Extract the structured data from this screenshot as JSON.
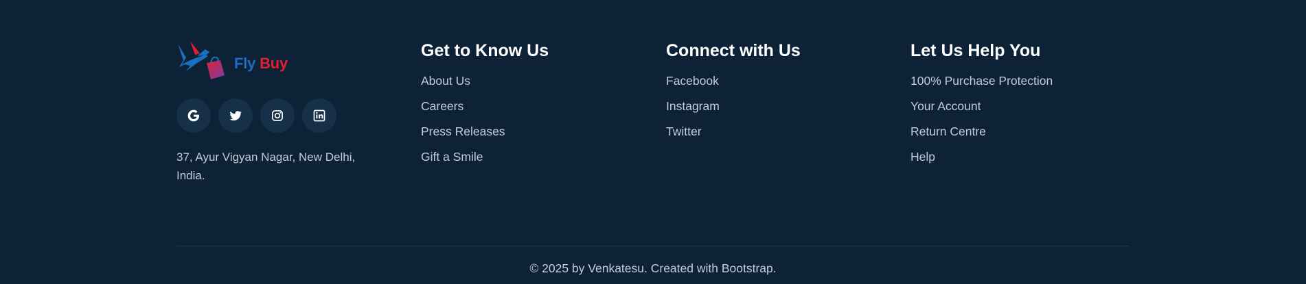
{
  "brand": {
    "name_part1": "Fly",
    "name_part2": "Buy",
    "address": "37, Ayur Vigyan Nagar, New Delhi, India.",
    "colors": {
      "blue": "#1a6fc1",
      "red": "#e02031",
      "background": "#0d2236"
    }
  },
  "socials": [
    {
      "icon": "google-icon"
    },
    {
      "icon": "twitter-icon"
    },
    {
      "icon": "instagram-icon"
    },
    {
      "icon": "linkedin-icon"
    }
  ],
  "columns": [
    {
      "heading": "Get to Know Us",
      "links": [
        "About Us",
        "Careers",
        "Press Releases",
        "Gift a Smile"
      ]
    },
    {
      "heading": "Connect with Us",
      "links": [
        "Facebook",
        "Instagram",
        "Twitter"
      ]
    },
    {
      "heading": "Let Us Help You",
      "links": [
        "100% Purchase Protection",
        "Your Account",
        "Return Centre",
        "Help"
      ]
    }
  ],
  "footer": {
    "copyright": "© 2025 by Venkatesu. Created with Bootstrap."
  }
}
